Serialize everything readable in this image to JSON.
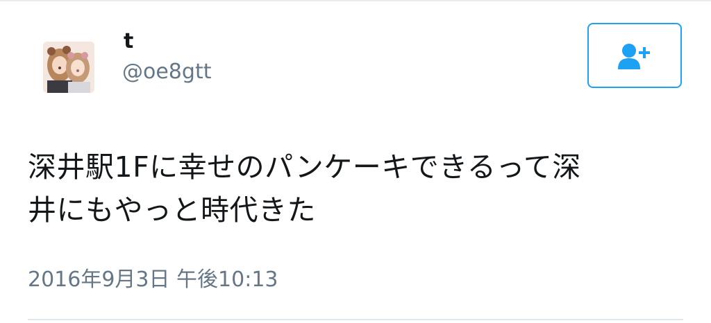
{
  "user": {
    "display_name": "t",
    "handle": "@oe8gtt",
    "avatar_icon": "user-avatar-photo"
  },
  "follow_button": {
    "icon": "add-user-icon",
    "accent_color": "#1da1f2"
  },
  "tweet": {
    "text_lines": [
      "深井駅1Fに幸せのパンケーキできるって深",
      "井にもやっと時代きた"
    ],
    "timestamp": "2016年9月3日 午後10:13"
  },
  "colors": {
    "text_primary": "#14171a",
    "text_secondary": "#657786",
    "divider": "#e1e8ed"
  }
}
